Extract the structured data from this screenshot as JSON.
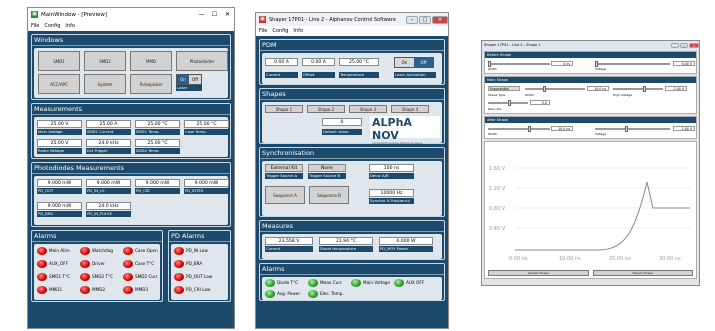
{
  "main": {
    "title": "MainWindow - [Preview]",
    "menu": [
      "File",
      "Config",
      "Info"
    ],
    "windows": {
      "header": "Windows",
      "buttons": [
        "SMD1",
        "SMD2",
        "MMD",
        "Photodiodes",
        "ACC/APC",
        "System",
        "Pulsepicker"
      ],
      "laser": "Laser",
      "on": "On",
      "off": "Off"
    },
    "measurements": {
      "header": "Measurements",
      "values": [
        "25.00 V",
        "25.00 A",
        "25.00 °C",
        "25.00 °C",
        "25.00 V",
        "24.0 kHz",
        "25.00 °C"
      ],
      "labels": [
        "Main Voltage",
        "SMD1 Current",
        "SMD1 Temp.",
        "Case Temp.",
        "Radio Voltage",
        "Ext Trigger",
        "SMD2 Temp."
      ]
    },
    "photodiodes": {
      "header": "Photodiodes Measurements",
      "values": [
        "9.000 mW",
        "9.000 mW",
        "9.000 mW",
        "9.000 mW",
        "9.000 mW",
        "24.0 kHz"
      ],
      "labels": [
        "PD_OUT",
        "PD_IN_LS",
        "PD_CRI",
        "PD_INTER",
        "PD_BRA",
        "PD_IN_PULSE"
      ]
    },
    "alarms": {
      "header": "Alarms",
      "items": [
        "Main Alim",
        "Watchdog",
        "Case Open",
        "AUX_OFF",
        "Driver",
        "Case T°C",
        "SMD1 T°C",
        "SMD2 T°C",
        "SMD2 Curr.",
        "MMD1",
        "MMD2",
        "MMD3"
      ]
    },
    "pd_alarms": {
      "header": "PD Alarms",
      "items": [
        "PD_IN Low",
        "PD_BRA",
        "PD_OUT Low",
        "PD_CRI Low"
      ]
    }
  },
  "shaper": {
    "title": "Shaper 17P01 - Line 2 - Alphanov Control Software",
    "menu": [
      "File",
      "Config",
      "Info"
    ],
    "pdm": {
      "header": "PDM",
      "current": "0.00 A",
      "offset": "0.00 A",
      "temperature": "25.00 °C",
      "on": "On",
      "off": "Off",
      "labels": [
        "Current",
        "Offset",
        "Temperature",
        "Laser Activation"
      ]
    },
    "shapes": {
      "header": "Shapes",
      "buttons": [
        "Shape 1",
        "Shape 2",
        "Shape 3",
        "Shape 4"
      ],
      "default_value": "0",
      "default_label": "Default Value",
      "logo": "ALPhA NOV",
      "logo_sub": "Centre Technologique Optique et Lasers"
    },
    "sync": {
      "header": "Synchronisation",
      "trigger_a": "External Kit",
      "trigger_b": "None",
      "delay": "100 ns",
      "labels": [
        "Trigger Source A",
        "Trigger Source B",
        "Delay A/B",
        "Synchro A Frequency"
      ],
      "seq_a": "Sequence A",
      "seq_b": "Sequence B",
      "freq": "10000 Hz"
    },
    "measures": {
      "header": "Measures",
      "values": [
        "23.558 V",
        "21.94 °C",
        "0.000 W"
      ],
      "labels": [
        "Current",
        "Diode temperature",
        "PD_MOY Power"
      ]
    },
    "alarms": {
      "header": "Alarms",
      "items": [
        "Diode T°C",
        "Mean Curr.",
        "Main Voltage",
        "AUX OFF",
        "Avg. Power",
        "Elec. Temp."
      ]
    }
  },
  "shape_win": {
    "title": "Shaper 17P01 - Line 2 - Shape 1",
    "before": {
      "header": "Before Shape",
      "field": "0 ns",
      "field2": "0.00 V",
      "labels": [
        "Width",
        "Voltage"
      ]
    },
    "main": {
      "header": "Main Shape",
      "dropdown": "Exponential",
      "width": "10.0 ns",
      "height": "2.00 V",
      "rise": "5.0",
      "labels": [
        "Shape Type",
        "Width",
        "High Voltage",
        "Rise rate"
      ]
    },
    "after": {
      "header": "After Shape",
      "field": "10.0 ns",
      "field2": "1.00 V",
      "labels": [
        "Width",
        "Voltage"
      ]
    },
    "chart_data": {
      "type": "line",
      "yticks": [
        "1.60 V",
        "1.20 V",
        "0.80 V",
        "0.40 V"
      ],
      "xticks": [
        "0.00 ns",
        "10.00 ns",
        "20.00 ns",
        "30.00 ns"
      ]
    },
    "upload": "Upload Shape",
    "export": "Export Shape"
  }
}
